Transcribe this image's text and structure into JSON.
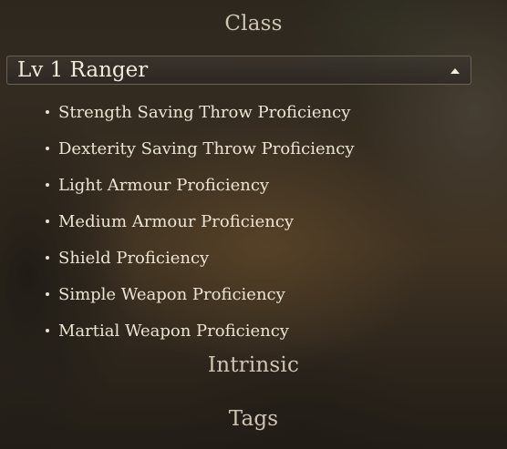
{
  "sections": {
    "class_title": "Class",
    "intrinsic_title": "Intrinsic",
    "tags_title": "Tags"
  },
  "class_header": {
    "label": "Lv 1 Ranger",
    "toggle_icon": "chevron-up-icon"
  },
  "proficiencies": [
    "Strength Saving Throw Proficiency",
    "Dexterity Saving Throw Proficiency",
    "Light Armour Proficiency",
    "Medium Armour Proficiency",
    "Shield Proficiency",
    "Simple Weapon Proficiency",
    "Martial Weapon Proficiency"
  ],
  "colors": {
    "text": "#ece4d3",
    "section_title": "#cfc5b2",
    "header_border": "#968c78"
  }
}
